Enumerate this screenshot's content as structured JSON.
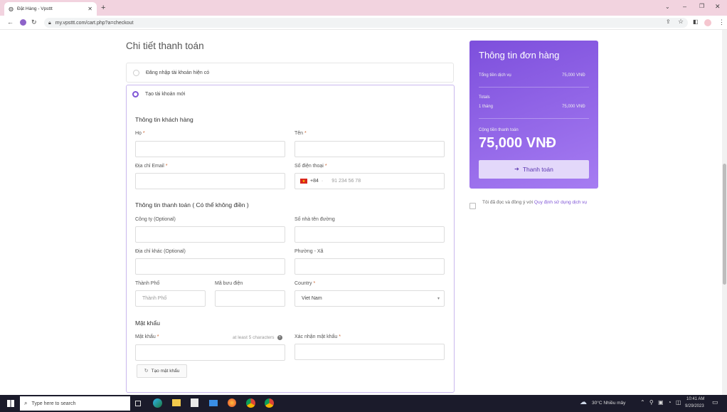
{
  "browser": {
    "tab_title": "Đặt Hàng - Vpsttt",
    "url": "my.vpsttt.com/cart.php?a=checkout"
  },
  "page": {
    "heading": "Chi tiết thanh toán",
    "login_option": "Đăng nhập tài khoản hiện có",
    "create_option": "Tạo tài khoản mới"
  },
  "customer": {
    "section": "Thông tin khách hàng",
    "last_name": "Họ",
    "first_name": "Tên",
    "email": "Địa chỉ Email",
    "phone": "Số điện thoại",
    "phone_code": "+84",
    "phone_placeholder": "91 234 56 78"
  },
  "billing": {
    "section": "Thông tin thanh toán ( Có thể không điền )",
    "company": "Công ty (Optional)",
    "street": "Số nhà tên đường",
    "address2": "Địa chỉ khác (Optional)",
    "ward": "Phường - Xã",
    "city": "Thành Phố",
    "city_placeholder": "Thành Phố",
    "postcode": "Mã bưu điện",
    "country": "Country",
    "country_value": "Viet Nam"
  },
  "password": {
    "section": "Mật khẩu",
    "label": "Mật khẩu",
    "hint": "at least 5 characters",
    "confirm": "Xác nhận mật khẩu",
    "generate": "Tạo mật khẩu"
  },
  "order": {
    "title": "Thông tin đơn hàng",
    "service_total_label": "Tổng tiền dịch vụ",
    "service_total_value": "75,000 VNĐ",
    "totals_label": "Totals",
    "period": "1 tháng",
    "period_value": "75,000 VNĐ",
    "grand_label": "Cộng tiền thanh toán",
    "grand_value": "75,000 VNĐ",
    "pay_button": "Thanh toán"
  },
  "terms": {
    "text": "Tôi đã đọc và đồng ý với",
    "link": "Quy định sử dụng dịch vụ"
  },
  "taskbar": {
    "search": "Type here to search",
    "weather": "30°C Nhiều mây",
    "time": "10:41 AM",
    "date": "9/29/2023"
  },
  "colors": {
    "accent": "#7f55d6",
    "panel_start": "#7d4fdc",
    "panel_end": "#a67cf2"
  }
}
